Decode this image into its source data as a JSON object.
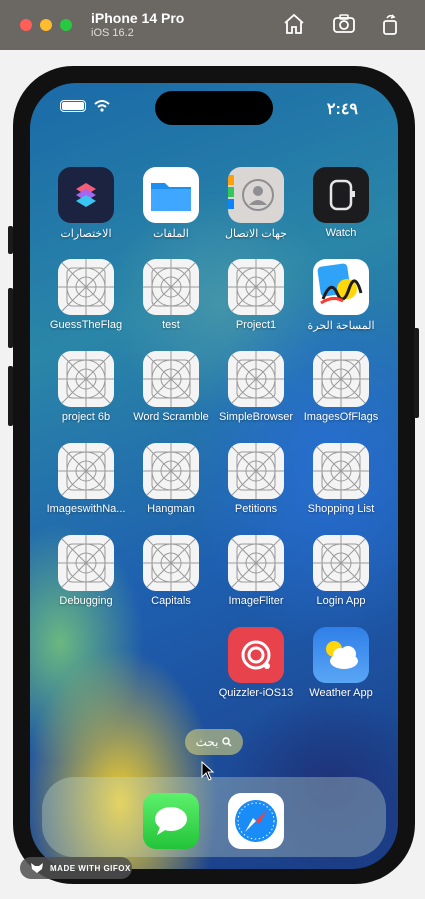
{
  "simulator": {
    "device_name": "iPhone 14 Pro",
    "os_version": "iOS 16.2",
    "toolbar_icons": [
      "home-icon",
      "screenshot-camera-icon",
      "rotate-icon"
    ]
  },
  "status_bar": {
    "time": "٢:٤٩",
    "icons": [
      "battery-icon",
      "wifi-icon"
    ]
  },
  "apps": [
    {
      "label": "الاختصارات",
      "icon": "shortcuts-icon"
    },
    {
      "label": "الملفات",
      "icon": "files-icon"
    },
    {
      "label": "جهات الاتصال",
      "icon": "contacts-icon"
    },
    {
      "label": "Watch",
      "icon": "watch-icon"
    },
    {
      "label": "GuessTheFlag",
      "icon": "placeholder-app-icon"
    },
    {
      "label": "test",
      "icon": "placeholder-app-icon"
    },
    {
      "label": "Project1",
      "icon": "placeholder-app-icon"
    },
    {
      "label": "المساحة الحرة",
      "icon": "freeform-icon"
    },
    {
      "label": "project 6b",
      "icon": "placeholder-app-icon"
    },
    {
      "label": "Word Scramble",
      "icon": "placeholder-app-icon"
    },
    {
      "label": "SimpleBrowser",
      "icon": "placeholder-app-icon"
    },
    {
      "label": "ImagesOfFlags",
      "icon": "placeholder-app-icon"
    },
    {
      "label": "ImageswithNa...",
      "icon": "placeholder-app-icon"
    },
    {
      "label": "Hangman",
      "icon": "placeholder-app-icon"
    },
    {
      "label": "Petitions",
      "icon": "placeholder-app-icon"
    },
    {
      "label": "Shopping List",
      "icon": "placeholder-app-icon"
    },
    {
      "label": "Debugging",
      "icon": "placeholder-app-icon"
    },
    {
      "label": "Capitals",
      "icon": "placeholder-app-icon"
    },
    {
      "label": "ImageFliter",
      "icon": "placeholder-app-icon"
    },
    {
      "label": "Login App",
      "icon": "placeholder-app-icon"
    },
    {
      "label": "Quizzler-iOS13",
      "icon": "quizzler-icon"
    },
    {
      "label": "Weather App",
      "icon": "weather-icon"
    }
  ],
  "search": {
    "label": "بحث",
    "icon": "search-icon"
  },
  "dock": [
    {
      "icon": "messages-icon"
    },
    {
      "icon": "safari-icon"
    }
  ],
  "watermark": {
    "label": "MADE WITH GIFOX"
  },
  "colors": {
    "titlebar": "#6b6763",
    "quizzler": "#e8434c",
    "messages": "#34c759",
    "weather": "#3a8df0"
  }
}
